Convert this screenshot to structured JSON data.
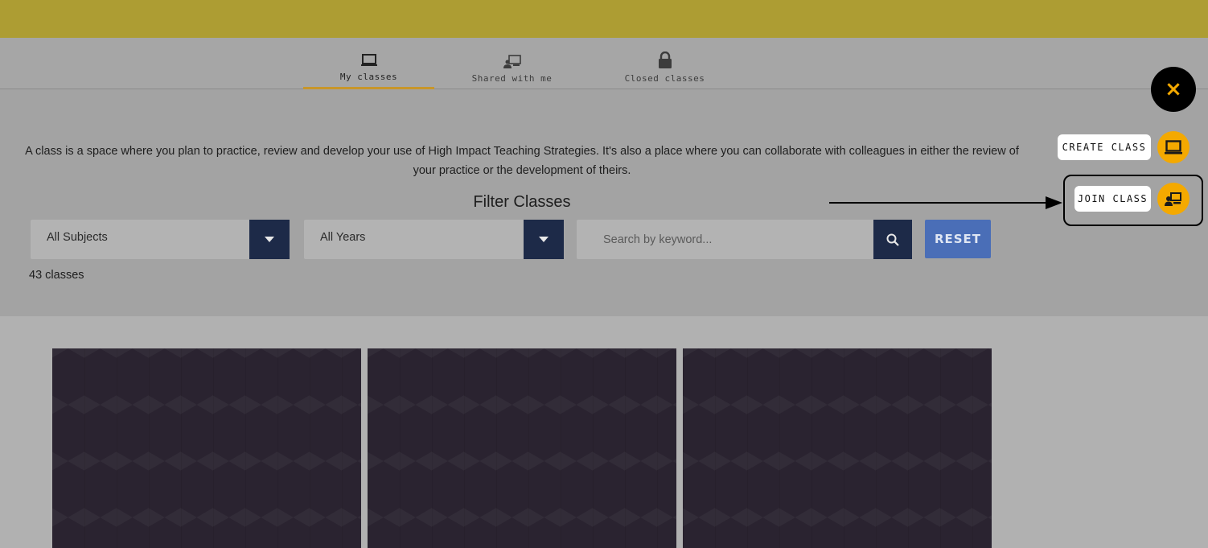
{
  "tabs": [
    {
      "label": "My classes",
      "icon": "laptop-icon",
      "active": true
    },
    {
      "label": "Shared with me",
      "icon": "shared-screen-icon",
      "active": false
    },
    {
      "label": "Closed classes",
      "icon": "lock-icon",
      "active": false
    }
  ],
  "intro_text": "A class is a space where you plan to practice, review and develop your use of High Impact Teaching Strategies. It's also a place where you can collaborate with colleagues in either the review of your practice or the development of theirs.",
  "filter": {
    "title": "Filter Classes",
    "subjects_value": "All Subjects",
    "years_value": "All Years",
    "search_placeholder": "Search by keyword...",
    "reset_label": "RESET"
  },
  "class_count": "43 classes",
  "fab": {
    "close_symbol": "×",
    "create_label": "CREATE CLASS",
    "join_label": "JOIN CLASS"
  },
  "colors": {
    "topbar": "#ad9d33",
    "navy": "#1d2a48",
    "reset_blue": "#4a6eb7",
    "fab_yellow": "#f4a900",
    "active_tab_underline": "#c8962a"
  }
}
